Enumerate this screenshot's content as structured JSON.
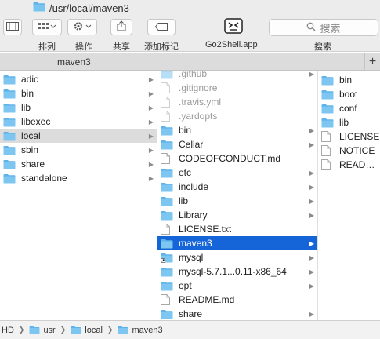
{
  "window": {
    "title": "/usr/local/maven3"
  },
  "toolbar": {
    "view_label": "排列",
    "action_label": "操作",
    "share_label": "共享",
    "tag_label": "添加标记",
    "go2shell_label": "Go2Shell.app",
    "search_label": "搜索",
    "search_placeholder": "搜索"
  },
  "tab": {
    "label": "maven3",
    "add_label": "+"
  },
  "column1": {
    "items": [
      {
        "label": "adic",
        "icon": "folder-icon",
        "arrow": true
      },
      {
        "label": "bin",
        "icon": "folder-icon",
        "arrow": true
      },
      {
        "label": "lib",
        "icon": "folder-icon",
        "arrow": true
      },
      {
        "label": "libexec",
        "icon": "folder-icon",
        "arrow": true
      },
      {
        "label": "local",
        "icon": "folder-icon",
        "arrow": true,
        "selected": "gray"
      },
      {
        "label": "sbin",
        "icon": "folder-icon",
        "arrow": true
      },
      {
        "label": "share",
        "icon": "folder-icon",
        "arrow": true
      },
      {
        "label": "standalone",
        "icon": "folder-icon",
        "arrow": true
      }
    ]
  },
  "column2": {
    "items": [
      {
        "label": ".github",
        "icon": "folder-icon",
        "arrow": true,
        "dim": true
      },
      {
        "label": ".gitignore",
        "icon": "document-icon",
        "arrow": false,
        "dim": true
      },
      {
        "label": ".travis.yml",
        "icon": "document-icon",
        "arrow": false,
        "dim": true
      },
      {
        "label": ".yardopts",
        "icon": "document-icon",
        "arrow": false,
        "dim": true
      },
      {
        "label": "bin",
        "icon": "folder-icon",
        "arrow": true
      },
      {
        "label": "Cellar",
        "icon": "folder-icon",
        "arrow": true
      },
      {
        "label": "CODEOFCONDUCT.md",
        "icon": "document-icon",
        "arrow": false
      },
      {
        "label": "etc",
        "icon": "folder-icon",
        "arrow": true
      },
      {
        "label": "include",
        "icon": "folder-icon",
        "arrow": true
      },
      {
        "label": "lib",
        "icon": "folder-icon",
        "arrow": true
      },
      {
        "label": "Library",
        "icon": "folder-icon",
        "arrow": true
      },
      {
        "label": "LICENSE.txt",
        "icon": "document-icon",
        "arrow": false
      },
      {
        "label": "maven3",
        "icon": "folder-icon",
        "arrow": true,
        "selected": "blue"
      },
      {
        "label": "mysql",
        "icon": "folder-alias-icon",
        "arrow": true
      },
      {
        "label": "mysql-5.7.1...0.11-x86_64",
        "icon": "folder-icon",
        "arrow": true
      },
      {
        "label": "opt",
        "icon": "folder-icon",
        "arrow": true
      },
      {
        "label": "README.md",
        "icon": "document-icon",
        "arrow": false
      },
      {
        "label": "share",
        "icon": "folder-icon",
        "arrow": true
      }
    ]
  },
  "column3": {
    "items": [
      {
        "label": "bin",
        "icon": "folder-icon"
      },
      {
        "label": "boot",
        "icon": "folder-icon"
      },
      {
        "label": "conf",
        "icon": "folder-icon"
      },
      {
        "label": "lib",
        "icon": "folder-icon"
      },
      {
        "label": "LICENSE",
        "icon": "document-icon"
      },
      {
        "label": "NOTICE",
        "icon": "document-icon"
      },
      {
        "label": "README.txt",
        "icon": "document-icon"
      }
    ]
  },
  "pathbar": {
    "crumbs": [
      {
        "label": "HD",
        "icon": "none"
      },
      {
        "label": "usr",
        "icon": "folder-icon"
      },
      {
        "label": "local",
        "icon": "folder-icon"
      },
      {
        "label": "maven3",
        "icon": "folder-icon"
      }
    ]
  },
  "colors": {
    "folder": "#5fb3e8",
    "selection_blue": "#1565d8",
    "selection_gray": "#dcdcdc",
    "toolbar_bg": "#ececec"
  }
}
